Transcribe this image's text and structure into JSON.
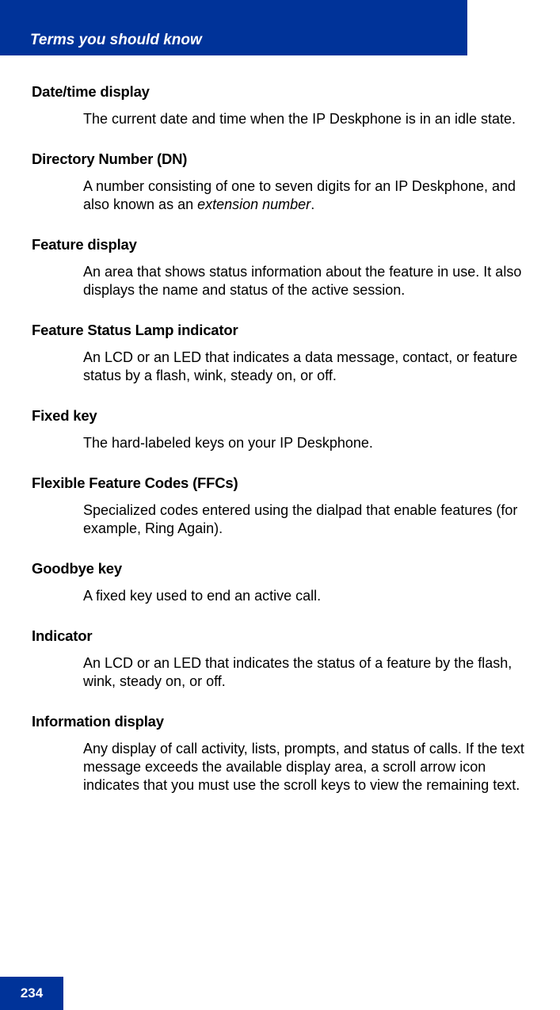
{
  "header": {
    "title": "Terms you should know"
  },
  "terms": [
    {
      "term": "Date/time display",
      "definition": "The current date and time when the IP Deskphone is in an idle state."
    },
    {
      "term": "Directory Number (DN)",
      "definition_prefix": "A number consisting of one to seven digits for an IP Deskphone, and also known as an ",
      "definition_italic": "extension number",
      "definition_suffix": "."
    },
    {
      "term": "Feature display",
      "definition": "An area that shows status information about the feature in use. It also displays the name and status of the active session."
    },
    {
      "term": "Feature Status Lamp indicator",
      "definition": "An LCD or an LED that indicates a data message, contact, or feature status by a flash, wink, steady on, or off."
    },
    {
      "term": "Fixed key",
      "definition": "The hard-labeled keys on your IP Deskphone."
    },
    {
      "term": "Flexible Feature Codes (FFCs)",
      "definition": "Specialized codes entered using the dialpad that enable features (for example, Ring Again)."
    },
    {
      "term": "Goodbye key",
      "definition": "A fixed key used to end an active call."
    },
    {
      "term": "Indicator",
      "definition": "An LCD or an LED that indicates the status of a feature by the flash, wink, steady on, or off."
    },
    {
      "term": "Information display",
      "definition": "Any display of call activity, lists, prompts, and status of calls. If the text message exceeds the available display area, a scroll arrow icon indicates that you must use the scroll keys to view the remaining text."
    }
  ],
  "footer": {
    "page_number": "234"
  }
}
